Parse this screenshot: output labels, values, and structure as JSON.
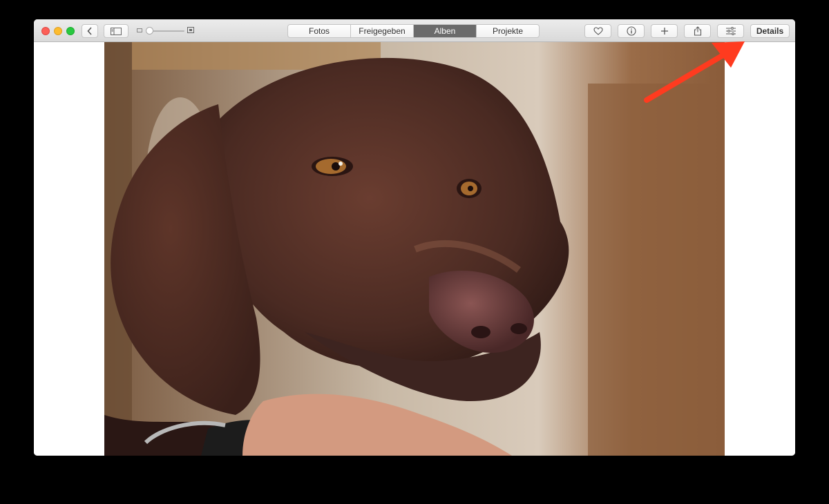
{
  "window": {
    "traffic_lights": [
      "close",
      "minimize",
      "zoom"
    ]
  },
  "toolbar": {
    "back_icon": "chevron-left-icon",
    "sidebar_icon": "sidebar-icon",
    "zoom_slider": {
      "level": 0
    },
    "tabs": [
      {
        "label": "Fotos",
        "active": false
      },
      {
        "label": "Freigegeben",
        "active": false
      },
      {
        "label": "Alben",
        "active": true
      },
      {
        "label": "Projekte",
        "active": false
      }
    ],
    "actions": [
      {
        "icon": "heart-icon"
      },
      {
        "icon": "info-icon"
      },
      {
        "icon": "plus-icon"
      },
      {
        "icon": "share-icon"
      },
      {
        "icon": "adjustments-icon"
      }
    ],
    "details_label": "Details"
  },
  "annotation": {
    "arrow_color": "#ff3b1f",
    "points_to": "adjustments-button"
  },
  "photo": {
    "subject": "brown dog portrait"
  }
}
